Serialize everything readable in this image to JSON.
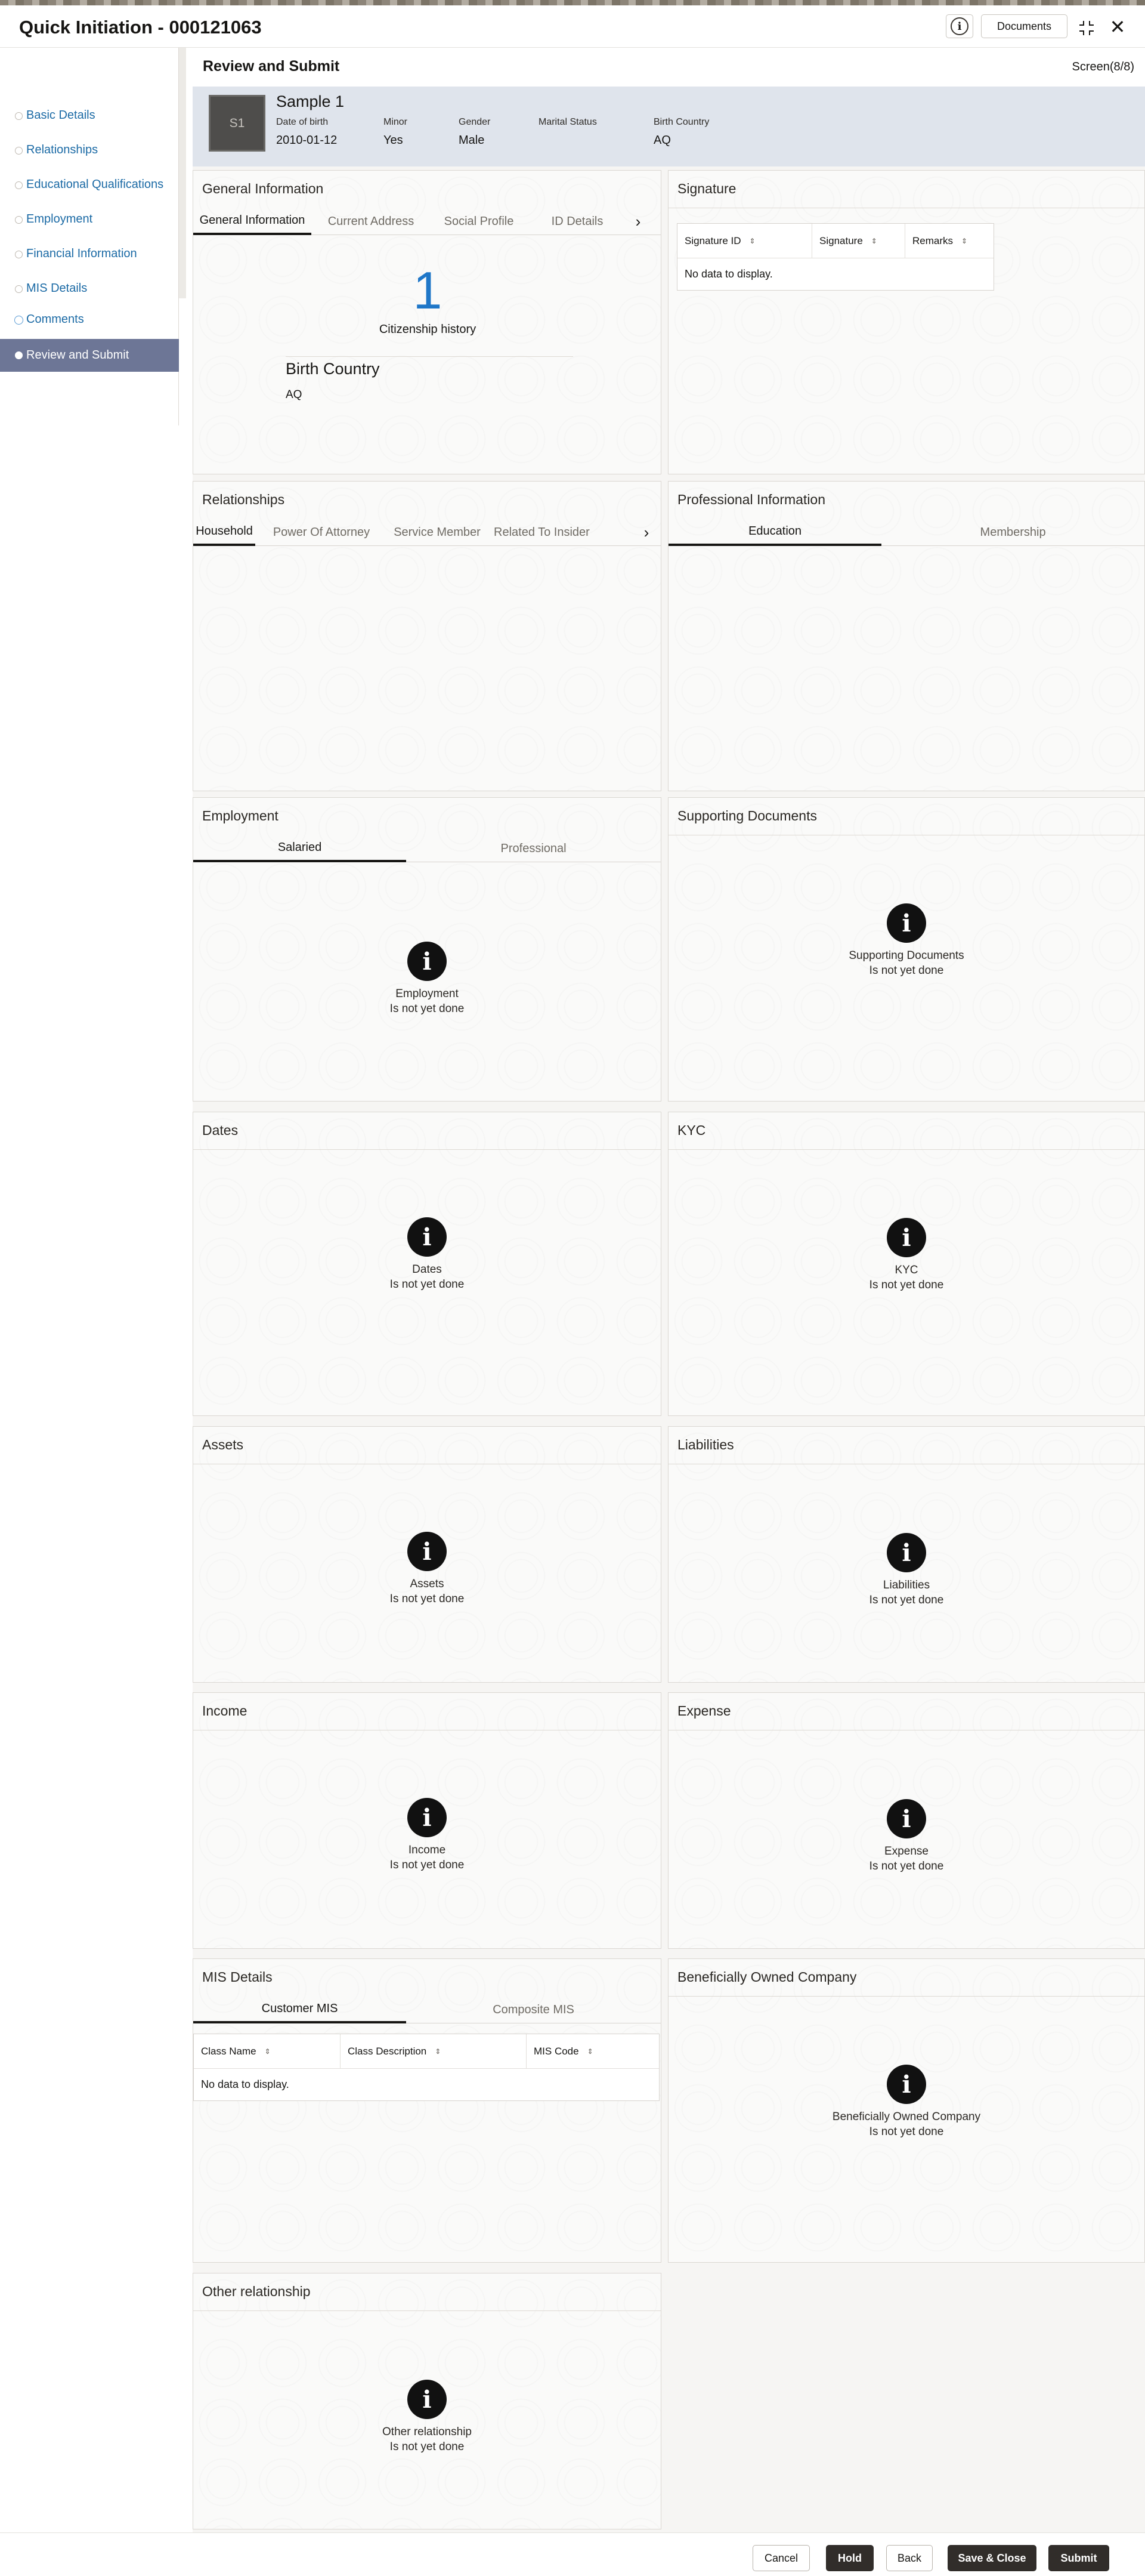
{
  "window": {
    "title": "Quick Initiation - 000121063",
    "documents_label": "Documents",
    "info_icon": "info-icon",
    "minimize_icon": "collapse-icon",
    "close_icon": "close-icon"
  },
  "sidebar": {
    "items": [
      {
        "label": "Basic Details"
      },
      {
        "label": "Relationships"
      },
      {
        "label": "Educational Qualifications"
      },
      {
        "label": "Employment"
      },
      {
        "label": "Financial Information"
      },
      {
        "label": "MIS Details"
      },
      {
        "label": "Comments"
      },
      {
        "label": "Review and Submit"
      }
    ]
  },
  "main": {
    "title": "Review and Submit",
    "screen": "Screen(8/8)"
  },
  "profile": {
    "avatar": "S1",
    "name": "Sample 1",
    "dob_label": "Date of birth",
    "dob": "2010-01-12",
    "minor_label": "Minor",
    "minor": "Yes",
    "gender_label": "Gender",
    "gender": "Male",
    "marital_label": "Marital Status",
    "marital": "",
    "country_label": "Birth Country",
    "country": "AQ"
  },
  "general": {
    "title": "General Information",
    "tabs": [
      "General Information",
      "Current Address",
      "Social Profile",
      "ID Details"
    ],
    "count": "1",
    "count_label": "Citizenship history",
    "country_label": "Birth Country",
    "country": "AQ"
  },
  "signature": {
    "title": "Signature",
    "cols": [
      "Signature ID",
      "Signature",
      "Remarks"
    ],
    "nodata": "No data to display."
  },
  "relationships": {
    "title": "Relationships",
    "tabs": [
      "Household",
      "Power Of Attorney",
      "Service Member",
      "Related To Insider"
    ]
  },
  "professional": {
    "title": "Professional Information",
    "tabs": [
      "Education",
      "Membership"
    ]
  },
  "employment": {
    "title": "Employment",
    "tabs": [
      "Salaried",
      "Professional"
    ],
    "l1": "Employment",
    "l2": "Is not yet done"
  },
  "supporting": {
    "title": "Supporting Documents",
    "l1": "Supporting Documents",
    "l2": "Is not yet done"
  },
  "dates": {
    "title": "Dates",
    "l1": "Dates",
    "l2": "Is not yet done"
  },
  "kyc": {
    "title": "KYC",
    "l1": "KYC",
    "l2": "Is not yet done"
  },
  "assets": {
    "title": "Assets",
    "l1": "Assets",
    "l2": "Is not yet done"
  },
  "liabilities": {
    "title": "Liabilities",
    "l1": "Liabilities",
    "l2": "Is not yet done"
  },
  "income": {
    "title": "Income",
    "l1": "Income",
    "l2": "Is not yet done"
  },
  "expense": {
    "title": "Expense",
    "l1": "Expense",
    "l2": "Is not yet done"
  },
  "mis": {
    "title": "MIS Details",
    "tabs": [
      "Customer MIS",
      "Composite MIS"
    ],
    "cols": [
      "Class Name",
      "Class Description",
      "MIS Code"
    ],
    "nodata": "No data to display."
  },
  "boc": {
    "title": "Beneficially Owned Company",
    "l1": "Beneficially Owned Company",
    "l2": "Is not yet done"
  },
  "other": {
    "title": "Other relationship",
    "l1": "Other relationship",
    "l2": "Is not yet done"
  },
  "footer": {
    "cancel": "Cancel",
    "hold": "Hold",
    "back": "Back",
    "save_close": "Save & Close",
    "submit": "Submit"
  }
}
